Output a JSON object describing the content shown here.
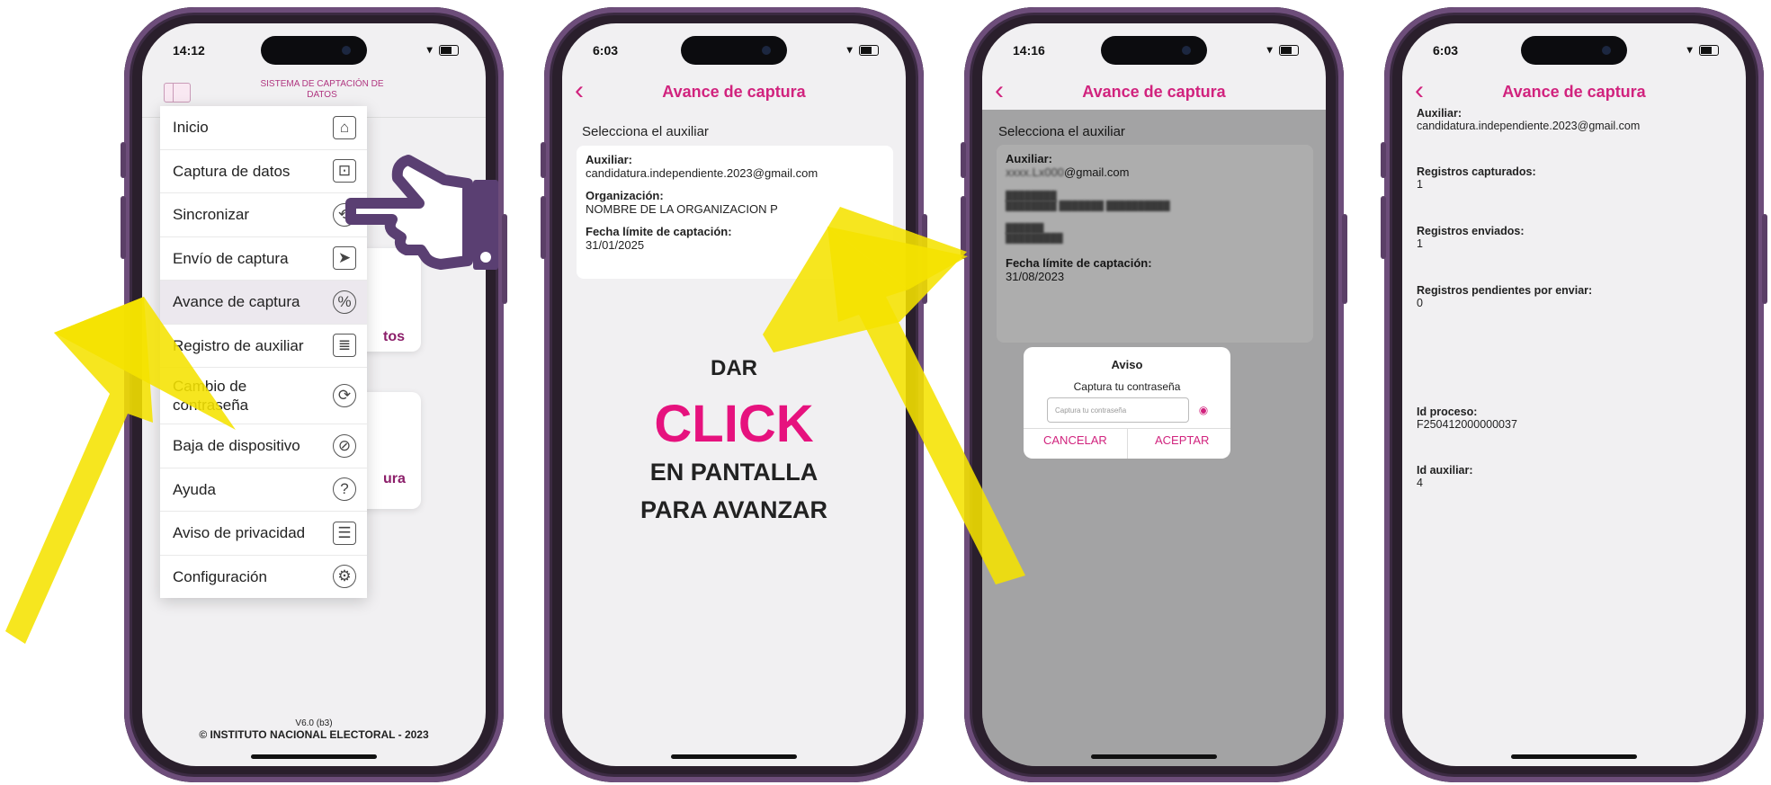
{
  "colors": {
    "accent": "#d1237e",
    "arrow": "#f5e200",
    "frame": "#6d4d7a"
  },
  "phone1": {
    "time": "14:12",
    "header_title": "SISTEMA DE CAPTACIÓN DE DATOS",
    "menu": [
      {
        "label": "Inicio",
        "icon": "home-icon"
      },
      {
        "label": "Captura de datos",
        "icon": "scan-icon"
      },
      {
        "label": "Sincronizar",
        "icon": "sync-icon"
      },
      {
        "label": "Envío de captura",
        "icon": "send-icon"
      },
      {
        "label": "Avance de captura",
        "icon": "percent-icon"
      },
      {
        "label": "Registro de auxiliar",
        "icon": "register-icon"
      },
      {
        "label": "Cambio de contraseña",
        "icon": "password-icon"
      },
      {
        "label": "Baja de dispositivo",
        "icon": "device-off-icon"
      },
      {
        "label": "Ayuda",
        "icon": "help-icon"
      },
      {
        "label": "Aviso de privacidad",
        "icon": "privacy-icon"
      },
      {
        "label": "Configuración",
        "icon": "settings-icon"
      }
    ],
    "behind_fragment_1": "tos",
    "behind_fragment_2": "ura",
    "version": "V6.0 (b3)",
    "copyright": "© INSTITUTO NACIONAL ELECTORAL - 2023"
  },
  "phone2": {
    "time": "6:03",
    "nav_title": "Avance de captura",
    "section_title": "Selecciona el auxiliar",
    "auxiliar_label": "Auxiliar:",
    "auxiliar_value": "candidatura.independiente.2023@gmail.com",
    "org_label": "Organización:",
    "org_value": "NOMBRE DE LA ORGANIZACION P",
    "fecha_label": "Fecha límite de captación:",
    "fecha_value": "31/01/2025",
    "instr_1": "DAR",
    "instr_2": "CLICK",
    "instr_3": "EN PANTALLA",
    "instr_4": "PARA AVANZAR"
  },
  "phone3": {
    "time": "14:16",
    "nav_title": "Avance de captura",
    "section_title": "Selecciona el auxiliar",
    "auxiliar_label": "Auxiliar:",
    "auxiliar_value": "@gmail.com",
    "fecha_label": "Fecha límite de captación:",
    "fecha_value": "31/08/2023",
    "dialog_title": "Aviso",
    "dialog_message": "Captura tu contraseña",
    "dialog_placeholder": "Captura tu contraseña",
    "cancel_label": "CANCELAR",
    "accept_label": "ACEPTAR"
  },
  "phone4": {
    "time": "6:03",
    "nav_title": "Avance de captura",
    "auxiliar_label": "Auxiliar:",
    "auxiliar_value": "candidatura.independiente.2023@gmail.com",
    "capturados_label": "Registros capturados:",
    "capturados_value": "1",
    "enviados_label": "Registros enviados:",
    "enviados_value": "1",
    "pendientes_label": "Registros pendientes por enviar:",
    "pendientes_value": "0",
    "proceso_label": "Id proceso:",
    "proceso_value": "F250412000000037",
    "aux_id_label": "Id auxiliar:",
    "aux_id_value": "4"
  }
}
